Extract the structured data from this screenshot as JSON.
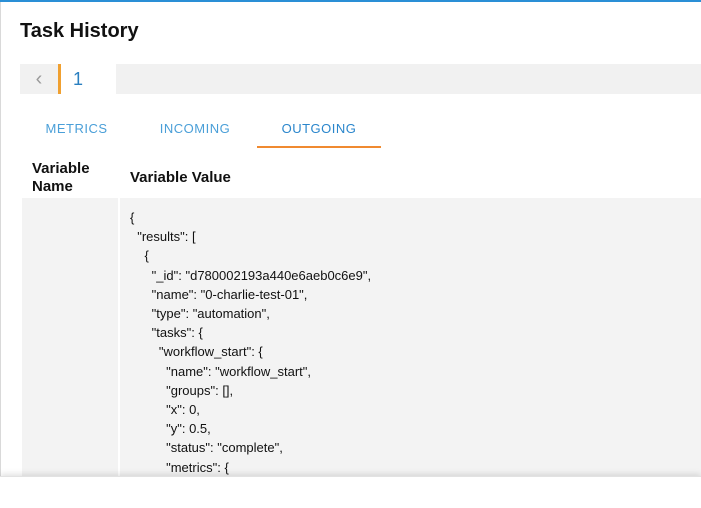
{
  "page": {
    "title": "Task History"
  },
  "pagination": {
    "prev_icon": "chevron-left-icon",
    "current_page": "1"
  },
  "tabs": [
    {
      "label": "METRICS",
      "active": false
    },
    {
      "label": "INCOMING",
      "active": false
    },
    {
      "label": "OUTGOING",
      "active": true
    }
  ],
  "table": {
    "headers": {
      "name": "Variable\nName",
      "value": "Variable Value"
    },
    "rows": [
      {
        "name": "",
        "value": "{\n  \"results\": [\n    {\n      \"_id\": \"d780002193a440e6aeb0c6e9\",\n      \"name\": \"0-charlie-test-01\",\n      \"type\": \"automation\",\n      \"tasks\": {\n        \"workflow_start\": {\n          \"name\": \"workflow_start\",\n          \"groups\": [],\n          \"x\": 0,\n          \"y\": 0.5,\n          \"status\": \"complete\",\n          \"metrics\": {"
      }
    ]
  },
  "colors": {
    "accent_blue": "#2a86cc",
    "accent_orange": "#f08a30",
    "top_border": "#2a8fd6"
  }
}
